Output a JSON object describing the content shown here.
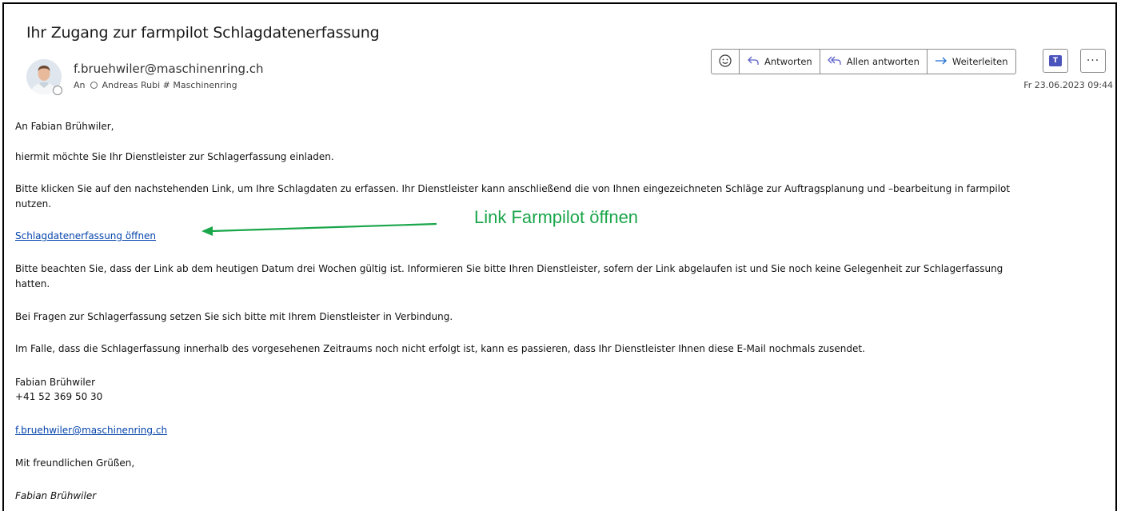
{
  "email": {
    "subject": "Ihr Zugang zur farmpilot Schlagdatenerfassung",
    "sender": "f.bruehwiler@maschinenring.ch",
    "to_label": "An",
    "to_recipient": "Andreas Rubi # Maschinenring",
    "date": "Fr 23.06.2023 09:44"
  },
  "toolbar": {
    "emoji_icon": "emoji-icon",
    "reply_label": "Antworten",
    "reply_all_label": "Allen antworten",
    "forward_label": "Weiterleiten",
    "teams_icon": "teams-icon",
    "more_icon": "more-icon"
  },
  "body": {
    "greeting": "An Fabian Brühwiler,",
    "p1": "hiermit möchte Sie Ihr Dienstleister zur Schlagerfassung einladen.",
    "p2_line1": "Bitte klicken Sie auf den nachstehenden Link, um Ihre Schlagdaten zu erfassen. Ihr Dienstleister kann anschließend die von Ihnen eingezeichneten Schläge zur Auftragsplanung und –bearbeitung in farmpilot",
    "p2_line2": "nutzen.",
    "link_text": "Schlagdatenerfassung öffnen",
    "p3_line1": "Bitte beachten Sie, dass der Link ab dem heutigen Datum drei Wochen gültig ist. Informieren Sie bitte Ihren Dienstleister, sofern der Link abgelaufen ist und Sie noch keine Gelegenheit zur Schlagerfassung",
    "p3_line2": "hatten.",
    "p4": "Bei Fragen zur Schlagerfassung setzen Sie sich bitte mit Ihrem Dienstleister in Verbindung.",
    "p5": "Im Falle, dass die Schlagerfassung innerhalb des vorgesehenen Zeitraums noch nicht erfolgt ist, kann es passieren, dass Ihr Dienstleister Ihnen diese E-Mail nochmals zusendet.",
    "sig_name": "Fabian Brühwiler",
    "sig_phone": "+41 52 369 50 30",
    "sig_email": "f.bruehwiler@maschinenring.ch",
    "closing": "Mit freundlichen Grüßen,",
    "closing_name": "Fabian Brühwiler"
  },
  "annotation": {
    "text": "Link Farmpilot öffnen",
    "color": "#1aa64a"
  }
}
